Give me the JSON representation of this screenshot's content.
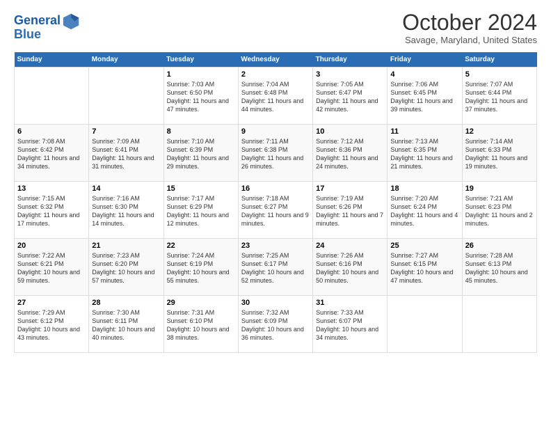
{
  "header": {
    "logo_line1": "General",
    "logo_line2": "Blue",
    "month": "October 2024",
    "location": "Savage, Maryland, United States"
  },
  "weekdays": [
    "Sunday",
    "Monday",
    "Tuesday",
    "Wednesday",
    "Thursday",
    "Friday",
    "Saturday"
  ],
  "weeks": [
    [
      {
        "day": "",
        "sunrise": "",
        "sunset": "",
        "daylight": ""
      },
      {
        "day": "",
        "sunrise": "",
        "sunset": "",
        "daylight": ""
      },
      {
        "day": "1",
        "sunrise": "Sunrise: 7:03 AM",
        "sunset": "Sunset: 6:50 PM",
        "daylight": "Daylight: 11 hours and 47 minutes."
      },
      {
        "day": "2",
        "sunrise": "Sunrise: 7:04 AM",
        "sunset": "Sunset: 6:48 PM",
        "daylight": "Daylight: 11 hours and 44 minutes."
      },
      {
        "day": "3",
        "sunrise": "Sunrise: 7:05 AM",
        "sunset": "Sunset: 6:47 PM",
        "daylight": "Daylight: 11 hours and 42 minutes."
      },
      {
        "day": "4",
        "sunrise": "Sunrise: 7:06 AM",
        "sunset": "Sunset: 6:45 PM",
        "daylight": "Daylight: 11 hours and 39 minutes."
      },
      {
        "day": "5",
        "sunrise": "Sunrise: 7:07 AM",
        "sunset": "Sunset: 6:44 PM",
        "daylight": "Daylight: 11 hours and 37 minutes."
      }
    ],
    [
      {
        "day": "6",
        "sunrise": "Sunrise: 7:08 AM",
        "sunset": "Sunset: 6:42 PM",
        "daylight": "Daylight: 11 hours and 34 minutes."
      },
      {
        "day": "7",
        "sunrise": "Sunrise: 7:09 AM",
        "sunset": "Sunset: 6:41 PM",
        "daylight": "Daylight: 11 hours and 31 minutes."
      },
      {
        "day": "8",
        "sunrise": "Sunrise: 7:10 AM",
        "sunset": "Sunset: 6:39 PM",
        "daylight": "Daylight: 11 hours and 29 minutes."
      },
      {
        "day": "9",
        "sunrise": "Sunrise: 7:11 AM",
        "sunset": "Sunset: 6:38 PM",
        "daylight": "Daylight: 11 hours and 26 minutes."
      },
      {
        "day": "10",
        "sunrise": "Sunrise: 7:12 AM",
        "sunset": "Sunset: 6:36 PM",
        "daylight": "Daylight: 11 hours and 24 minutes."
      },
      {
        "day": "11",
        "sunrise": "Sunrise: 7:13 AM",
        "sunset": "Sunset: 6:35 PM",
        "daylight": "Daylight: 11 hours and 21 minutes."
      },
      {
        "day": "12",
        "sunrise": "Sunrise: 7:14 AM",
        "sunset": "Sunset: 6:33 PM",
        "daylight": "Daylight: 11 hours and 19 minutes."
      }
    ],
    [
      {
        "day": "13",
        "sunrise": "Sunrise: 7:15 AM",
        "sunset": "Sunset: 6:32 PM",
        "daylight": "Daylight: 11 hours and 17 minutes."
      },
      {
        "day": "14",
        "sunrise": "Sunrise: 7:16 AM",
        "sunset": "Sunset: 6:30 PM",
        "daylight": "Daylight: 11 hours and 14 minutes."
      },
      {
        "day": "15",
        "sunrise": "Sunrise: 7:17 AM",
        "sunset": "Sunset: 6:29 PM",
        "daylight": "Daylight: 11 hours and 12 minutes."
      },
      {
        "day": "16",
        "sunrise": "Sunrise: 7:18 AM",
        "sunset": "Sunset: 6:27 PM",
        "daylight": "Daylight: 11 hours and 9 minutes."
      },
      {
        "day": "17",
        "sunrise": "Sunrise: 7:19 AM",
        "sunset": "Sunset: 6:26 PM",
        "daylight": "Daylight: 11 hours and 7 minutes."
      },
      {
        "day": "18",
        "sunrise": "Sunrise: 7:20 AM",
        "sunset": "Sunset: 6:24 PM",
        "daylight": "Daylight: 11 hours and 4 minutes."
      },
      {
        "day": "19",
        "sunrise": "Sunrise: 7:21 AM",
        "sunset": "Sunset: 6:23 PM",
        "daylight": "Daylight: 11 hours and 2 minutes."
      }
    ],
    [
      {
        "day": "20",
        "sunrise": "Sunrise: 7:22 AM",
        "sunset": "Sunset: 6:21 PM",
        "daylight": "Daylight: 10 hours and 59 minutes."
      },
      {
        "day": "21",
        "sunrise": "Sunrise: 7:23 AM",
        "sunset": "Sunset: 6:20 PM",
        "daylight": "Daylight: 10 hours and 57 minutes."
      },
      {
        "day": "22",
        "sunrise": "Sunrise: 7:24 AM",
        "sunset": "Sunset: 6:19 PM",
        "daylight": "Daylight: 10 hours and 55 minutes."
      },
      {
        "day": "23",
        "sunrise": "Sunrise: 7:25 AM",
        "sunset": "Sunset: 6:17 PM",
        "daylight": "Daylight: 10 hours and 52 minutes."
      },
      {
        "day": "24",
        "sunrise": "Sunrise: 7:26 AM",
        "sunset": "Sunset: 6:16 PM",
        "daylight": "Daylight: 10 hours and 50 minutes."
      },
      {
        "day": "25",
        "sunrise": "Sunrise: 7:27 AM",
        "sunset": "Sunset: 6:15 PM",
        "daylight": "Daylight: 10 hours and 47 minutes."
      },
      {
        "day": "26",
        "sunrise": "Sunrise: 7:28 AM",
        "sunset": "Sunset: 6:13 PM",
        "daylight": "Daylight: 10 hours and 45 minutes."
      }
    ],
    [
      {
        "day": "27",
        "sunrise": "Sunrise: 7:29 AM",
        "sunset": "Sunset: 6:12 PM",
        "daylight": "Daylight: 10 hours and 43 minutes."
      },
      {
        "day": "28",
        "sunrise": "Sunrise: 7:30 AM",
        "sunset": "Sunset: 6:11 PM",
        "daylight": "Daylight: 10 hours and 40 minutes."
      },
      {
        "day": "29",
        "sunrise": "Sunrise: 7:31 AM",
        "sunset": "Sunset: 6:10 PM",
        "daylight": "Daylight: 10 hours and 38 minutes."
      },
      {
        "day": "30",
        "sunrise": "Sunrise: 7:32 AM",
        "sunset": "Sunset: 6:09 PM",
        "daylight": "Daylight: 10 hours and 36 minutes."
      },
      {
        "day": "31",
        "sunrise": "Sunrise: 7:33 AM",
        "sunset": "Sunset: 6:07 PM",
        "daylight": "Daylight: 10 hours and 34 minutes."
      },
      {
        "day": "",
        "sunrise": "",
        "sunset": "",
        "daylight": ""
      },
      {
        "day": "",
        "sunrise": "",
        "sunset": "",
        "daylight": ""
      }
    ]
  ]
}
